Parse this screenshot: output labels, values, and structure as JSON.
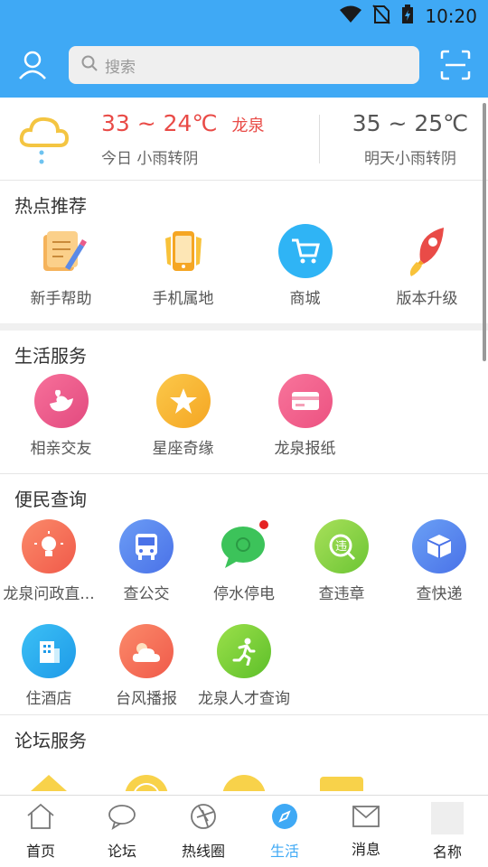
{
  "status_bar": {
    "time": "10:20"
  },
  "header": {
    "search_placeholder": "搜索"
  },
  "weather": {
    "today_temp": "33 ~ 24℃",
    "city": "龙泉",
    "today_desc": "今日 小雨转阴",
    "tomorrow_temp": "35 ~ 25℃",
    "tomorrow_desc": "明天小雨转阴"
  },
  "sections": {
    "hot": {
      "title": "热点推荐",
      "items": [
        {
          "label": "新手帮助",
          "icon": "scroll-pen-icon"
        },
        {
          "label": "手机属地",
          "icon": "phone-icon"
        },
        {
          "label": "商城",
          "icon": "cart-icon"
        },
        {
          "label": "版本升级",
          "icon": "rocket-icon"
        }
      ]
    },
    "life": {
      "title": "生活服务",
      "items": [
        {
          "label": "相亲交友",
          "icon": "bird-heart-icon"
        },
        {
          "label": "星座奇缘",
          "icon": "star-icon"
        },
        {
          "label": "龙泉报纸",
          "icon": "card-icon"
        }
      ]
    },
    "query": {
      "title": "便民查询",
      "items": [
        {
          "label": "龙泉问政直...",
          "icon": "bulb-icon"
        },
        {
          "label": "查公交",
          "icon": "bus-icon"
        },
        {
          "label": "停水停电",
          "icon": "chat-icon"
        },
        {
          "label": "查违章",
          "icon": "violation-icon"
        },
        {
          "label": "查快递",
          "icon": "box-icon"
        },
        {
          "label": "住酒店",
          "icon": "hotel-icon"
        },
        {
          "label": "台风播报",
          "icon": "weather-icon"
        },
        {
          "label": "龙泉人才查询",
          "icon": "runner-icon"
        }
      ]
    },
    "forum": {
      "title": "论坛服务"
    }
  },
  "tabs": [
    {
      "label": "首页",
      "icon": "home-icon"
    },
    {
      "label": "论坛",
      "icon": "chat-bubble-icon"
    },
    {
      "label": "热线圈",
      "icon": "aperture-icon"
    },
    {
      "label": "生活",
      "icon": "compass-icon",
      "active": true
    },
    {
      "label": "消息",
      "icon": "mail-icon"
    },
    {
      "label": "名称",
      "icon": "avatar-placeholder"
    }
  ],
  "colors": {
    "brand": "#3fa9f5",
    "today_temp": "#e94b47"
  }
}
